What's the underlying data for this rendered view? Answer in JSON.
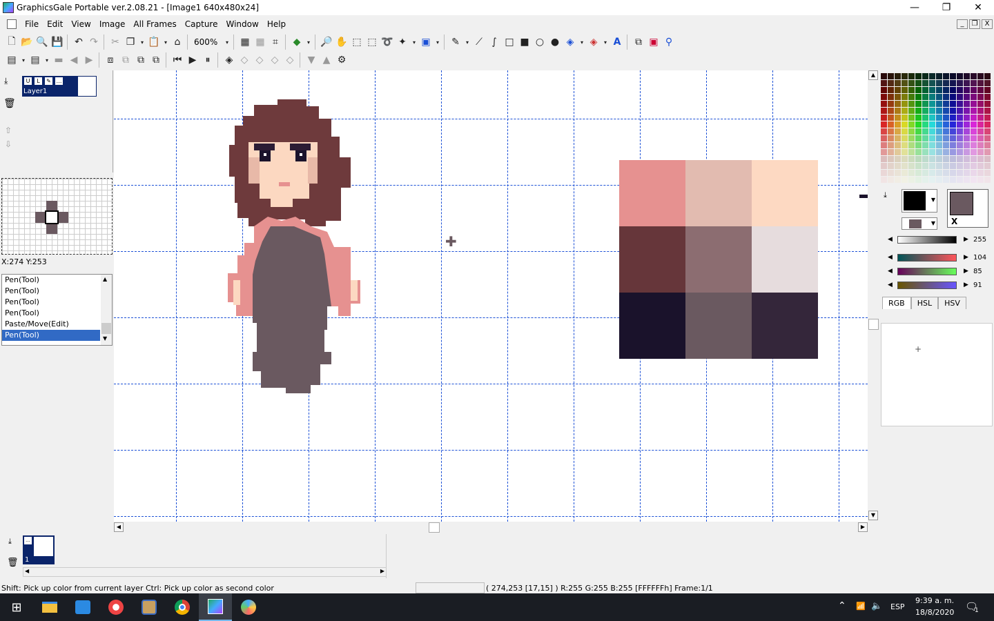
{
  "window": {
    "title": "GraphicsGale Portable ver.2.08.21 - [Image1 640x480x24]",
    "minimize_glyph": "—",
    "maximize_glyph": "❐",
    "close_glyph": "✕"
  },
  "menu": {
    "items": [
      "File",
      "Edit",
      "View",
      "Image",
      "All Frames",
      "Capture",
      "Window",
      "Help"
    ]
  },
  "mdi": {
    "min": "_",
    "restore": "❐",
    "close": "X"
  },
  "toolbar1": {
    "zoom": "600%",
    "icons": [
      "new-icon",
      "open-icon",
      "preview-icon",
      "save-icon",
      "undo-icon",
      "redo-icon",
      "cut-icon",
      "copy-icon",
      "paste-icon",
      "pick-icon",
      "grid-icon",
      "fine-grid-icon",
      "crop-icon",
      "color-reduce-icon",
      "zoom-icon",
      "hand-icon",
      "rect-select-icon",
      "lasso-icon",
      "free-select-icon",
      "magic-wand-icon",
      "color-select-icon",
      "pen-icon",
      "line-icon",
      "curve-icon",
      "rect-icon",
      "filled-rect-icon",
      "circle-icon",
      "filled-circle-icon",
      "fill-icon",
      "gradient-icon",
      "text-icon",
      "mask-icon",
      "frame-icon",
      "spray-icon"
    ]
  },
  "toolbar2": {
    "icons": [
      "layer-properties-icon",
      "frame-properties-icon",
      "frame-delete-icon",
      "prev-frame-icon",
      "next-frame-icon",
      "onion-skin-icon",
      "copy-frame-icon",
      "paste-frame-icon",
      "export-frame-icon",
      "first-frame-icon",
      "play-icon",
      "pause-icon",
      "insert-key-icon",
      "key-icon",
      "remove-key-icon",
      "add-key-icon",
      "delete-key-icon",
      "move-down-icon",
      "move-up-icon",
      "frame-settings-icon"
    ]
  },
  "layers": {
    "name": "Layer1"
  },
  "navigator": {
    "coords": "X:274 Y:253"
  },
  "history": {
    "items": [
      "Pen(Tool)",
      "Pen(Tool)",
      "Pen(Tool)",
      "Pen(Tool)",
      "Paste/Move(Edit)",
      "Pen(Tool)"
    ],
    "selected_index": 5
  },
  "swatches": [
    [
      "#e69190",
      "#e2bbb0",
      "#fdd9c2"
    ],
    [
      "#66363a",
      "#8c6d71",
      "#e6dcdd"
    ],
    [
      "#1a122b",
      "#6a5960",
      "#34263a"
    ]
  ],
  "color": {
    "fg": "#000000",
    "bg": "#6a5960",
    "brightness": "255",
    "r": "104",
    "g": "85",
    "b": "91",
    "tabs": [
      "RGB",
      "HSL",
      "HSV"
    ]
  },
  "frames": {
    "label": "1"
  },
  "status": {
    "hint": "Shift: Pick up color from current layer  Ctrl: Pick up color as second color",
    "info": "( 274,253 [17,15] ) R:255 G:255 B:255  [FFFFFFh]  Frame:1/1"
  },
  "taskbar": {
    "apps": [
      "explorer-icon",
      "remote-desktop-icon",
      "opera-icon",
      "sketch-app-icon",
      "chrome-icon",
      "graphicsgale-icon",
      "paint-app-icon"
    ],
    "lang": "ESP",
    "time": "9:39 a. m.",
    "date": "18/8/2020",
    "notification_count": "1"
  }
}
